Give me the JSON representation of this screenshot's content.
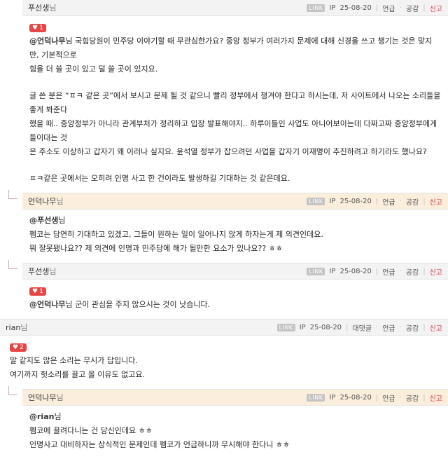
{
  "comments": [
    {
      "nick": "푸선생",
      "suffix": "님",
      "link": "LINK",
      "ip": "IP",
      "date": "25-08-20",
      "a1": "언급",
      "a2": "공감",
      "report": "신고",
      "likes": "1",
      "mention": "@언덕나무",
      "lines": [
        "님 국힘당원이 민주당 이야기할 때 무관심한가요? 중앙 정부가 여러가지 문제에 대해 신경을 쓰고 챙기는 것은 맞지만, 기본적으로",
        "힘을 더 쓸 곳이 있고 덜 쓸 곳이 있지요.",
        "",
        "글 쓴 분은 “ㅍㅋ 같은 곳”에서 보시고 문제 될 것 같으니 빨리 정부에서 챙겨야 한다고 하시는데, 저 사이트에서 나오는 소리들을 좋게 봐준다",
        "했을 때.. 중앙정부가 아니라 관계부처가 정리하고 입장 발표해야지.. 하루이틀인 사업도 아니어보이는데 다짜고짜 중앙정부에게 들이대는 것",
        "은 주소도 이상하고 갑자기 왜 이러나 싶지요. 윤석열 정부가 잡으려던 사업을 갑자기 이재명이 추진하려고 하기라도 했나요?",
        "",
        "ㅍㅋ같은 곳에서는 오히려 인명 사고 한 건이라도 발생하길 기대하는 것 같은데요."
      ]
    },
    {
      "nick": "언덕나무",
      "suffix": "님",
      "link": "LINK",
      "ip": "IP",
      "date": "25-08-20",
      "a1": "언급",
      "a2": "공감",
      "report": "신고",
      "mention": "@푸선생",
      "lines": [
        "님",
        "펨코는 당연히 기대하고 있겠고, 그들이 원하는 일이 일어나지 않게 하자는게 제 의견인데요.",
        "뭐 잘못됐나요?? 제 의견에 인명과 민주당에 해가 될만한 요소가 있나요?? ㅎㅎ"
      ]
    },
    {
      "nick": "푸선생",
      "suffix": "님",
      "link": "LINK",
      "ip": "IP",
      "date": "25-08-20",
      "a1": "언급",
      "a2": "공감",
      "report": "신고",
      "likes": "1",
      "mention": "@언덕나무",
      "lines": [
        "님 군이 관심을 주지 않으시는 것이 낫습니다."
      ]
    },
    {
      "nick": "rian",
      "suffix": "님",
      "link": "LINK",
      "ip": "IP",
      "date": "25-08-20",
      "a0": "대댓글",
      "a1": "언급",
      "a2": "공감",
      "report": "신고",
      "likes": "2",
      "lines": [
        "말 같지도 않은 소리는 무시가 답입니다.",
        "여기까지 헛소리를 끌고 올 이유도 없고요."
      ]
    },
    {
      "nick": "언덕나무",
      "suffix": "님",
      "link": "LINK",
      "ip": "IP",
      "date": "25-08-20",
      "a1": "언급",
      "a2": "공감",
      "report": "신고",
      "mention": "@rian",
      "lines": [
        "님",
        "펨코에 끌려다니는 건 당신인데요 ㅎㅎ",
        "인명사고 대비하자는 상식적인 문제인데 펨코가 언급하니까 무시해야 한다니 ㅎㅎ"
      ]
    }
  ],
  "colors": {
    "report": "#d9363e",
    "like": "#e84545",
    "reply_header": "#fbeedd"
  }
}
